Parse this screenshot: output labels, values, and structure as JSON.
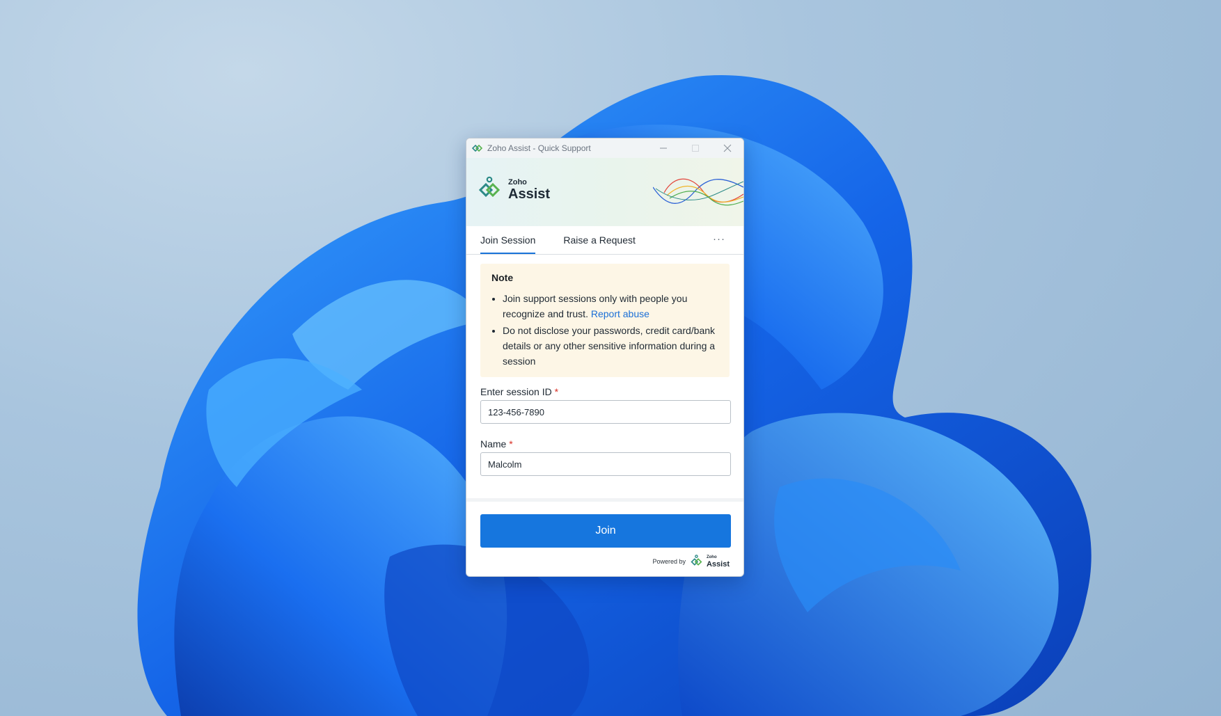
{
  "window": {
    "title": "Zoho Assist - Quick Support"
  },
  "brand": {
    "small": "Zoho",
    "name": "Assist"
  },
  "tabs": [
    {
      "label": "Join Session",
      "active": true
    },
    {
      "label": "Raise a Request",
      "active": false
    }
  ],
  "more_label": "···",
  "note": {
    "title": "Note",
    "item1_text": "Join support sessions only with people you recognize and trust.",
    "item1_link": "Report abuse",
    "item2_text": "Do not disclose your passwords, credit card/bank details or any other sensitive information during a session"
  },
  "form": {
    "session_label": "Enter session ID",
    "session_value": "123-456-7890",
    "name_label": "Name",
    "name_value": "Malcolm",
    "required_mark": "*"
  },
  "join_label": "Join",
  "powered": {
    "text": "Powered by",
    "small": "Zoho",
    "name": "Assist"
  },
  "colors": {
    "accent": "#1676de",
    "link": "#1a6fd6",
    "note_bg": "#fdf6e6",
    "required": "#d93025"
  },
  "icons": [
    "zoho-assist-logo-icon",
    "minimize-icon",
    "maximize-icon",
    "close-icon"
  ]
}
